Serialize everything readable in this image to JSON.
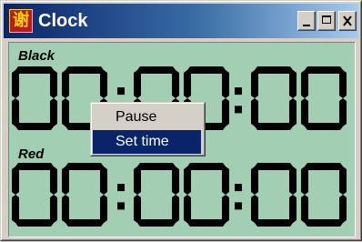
{
  "window": {
    "title": "Clock",
    "app_icon_glyph": "谢",
    "app_icon": "clock-app-icon",
    "controls": [
      "minimize",
      "maximize",
      "close"
    ]
  },
  "lcd": {
    "background_color": "#a2cfb3",
    "segment_color": "#000000",
    "black_clock": {
      "label": "Black",
      "time": "00:00:00"
    },
    "red_clock": {
      "label": "Red",
      "time": "00:00:00"
    }
  },
  "context_menu": {
    "items": [
      {
        "label": "Pause",
        "selected": false
      },
      {
        "label": "Set time",
        "selected": true
      }
    ]
  }
}
